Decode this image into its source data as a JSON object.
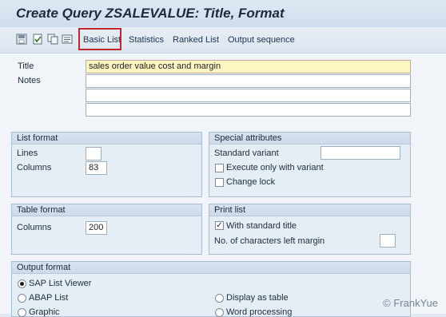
{
  "window": {
    "title": "Create Query ZSALEVALUE: Title, Format"
  },
  "toolbar": {
    "icons": [
      "save-icon",
      "check-icon",
      "copy-icon",
      "detail-icon"
    ],
    "tabs": [
      "Basic List",
      "Statistics",
      "Ranked List",
      "Output sequence"
    ]
  },
  "form": {
    "title_label": "Title",
    "title_value": "sales order value cost and margin",
    "notes_label": "Notes"
  },
  "list_format": {
    "heading": "List format",
    "lines_label": "Lines",
    "lines_value": "",
    "columns_label": "Columns",
    "columns_value": "83"
  },
  "special_attributes": {
    "heading": "Special attributes",
    "standard_variant_label": "Standard variant",
    "standard_variant_value": "",
    "execute_only_label": "Execute only with variant",
    "execute_only_checked": false,
    "change_lock_label": "Change lock",
    "change_lock_checked": false
  },
  "table_format": {
    "heading": "Table format",
    "columns_label": "Columns",
    "columns_value": "200"
  },
  "print_list": {
    "heading": "Print list",
    "with_standard_title_label": "With standard title",
    "with_standard_title_checked": true,
    "left_margin_label": "No. of characters left margin",
    "left_margin_value": ""
  },
  "output_format": {
    "heading": "Output format",
    "options": [
      {
        "label": "SAP List Viewer",
        "selected": true
      },
      {
        "label": "ABAP List",
        "selected": false
      },
      {
        "label": "Display as table",
        "selected": false
      },
      {
        "label": "Graphic",
        "selected": false
      },
      {
        "label": "Word processing",
        "selected": false
      }
    ]
  },
  "watermark": "© FrankYue",
  "colors": {
    "required_field": "#fdf6c0",
    "highlight_border": "#c0262d",
    "group_header": "#d7e3ef"
  }
}
